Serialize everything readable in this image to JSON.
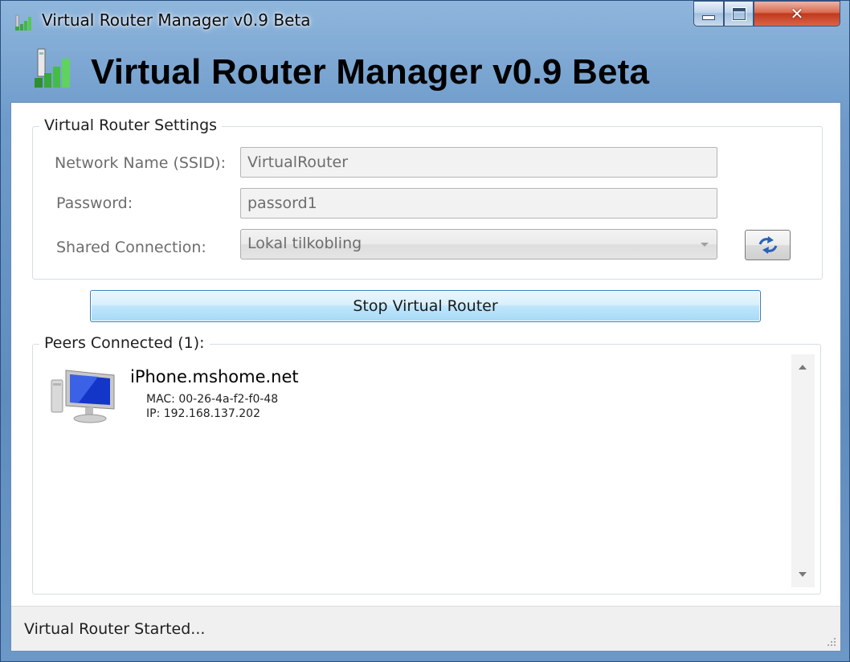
{
  "window": {
    "title": "Virtual Router Manager v0.9 Beta",
    "app_icon": "signal-bars-icon",
    "caption": {
      "minimize": "minimize-icon",
      "maximize": "maximize-icon",
      "close": "close-icon"
    }
  },
  "banner": {
    "title": "Virtual Router Manager v0.9 Beta",
    "icon": "router-signal-icon"
  },
  "settings": {
    "legend": "Virtual Router Settings",
    "ssid_label": "Network Name (SSID):",
    "ssid_value": "VirtualRouter",
    "password_label": "Password:",
    "password_value": "passord1",
    "shared_label": "Shared Connection:",
    "shared_value": "Lokal tilkobling",
    "refresh_icon": "refresh-icon"
  },
  "actions": {
    "stop_label": "Stop Virtual Router"
  },
  "peers": {
    "legend": "Peers Connected (1):",
    "items": [
      {
        "name": "iPhone.mshome.net",
        "mac": "MAC: 00-26-4a-f2-f0-48",
        "ip": "IP: 192.168.137.202",
        "icon": "computer-icon"
      }
    ]
  },
  "status": {
    "text": "Virtual Router Started..."
  },
  "colors": {
    "accent": "#3c7fb1",
    "window_frame": "#6e9bcb",
    "close_button": "#c1391c"
  }
}
